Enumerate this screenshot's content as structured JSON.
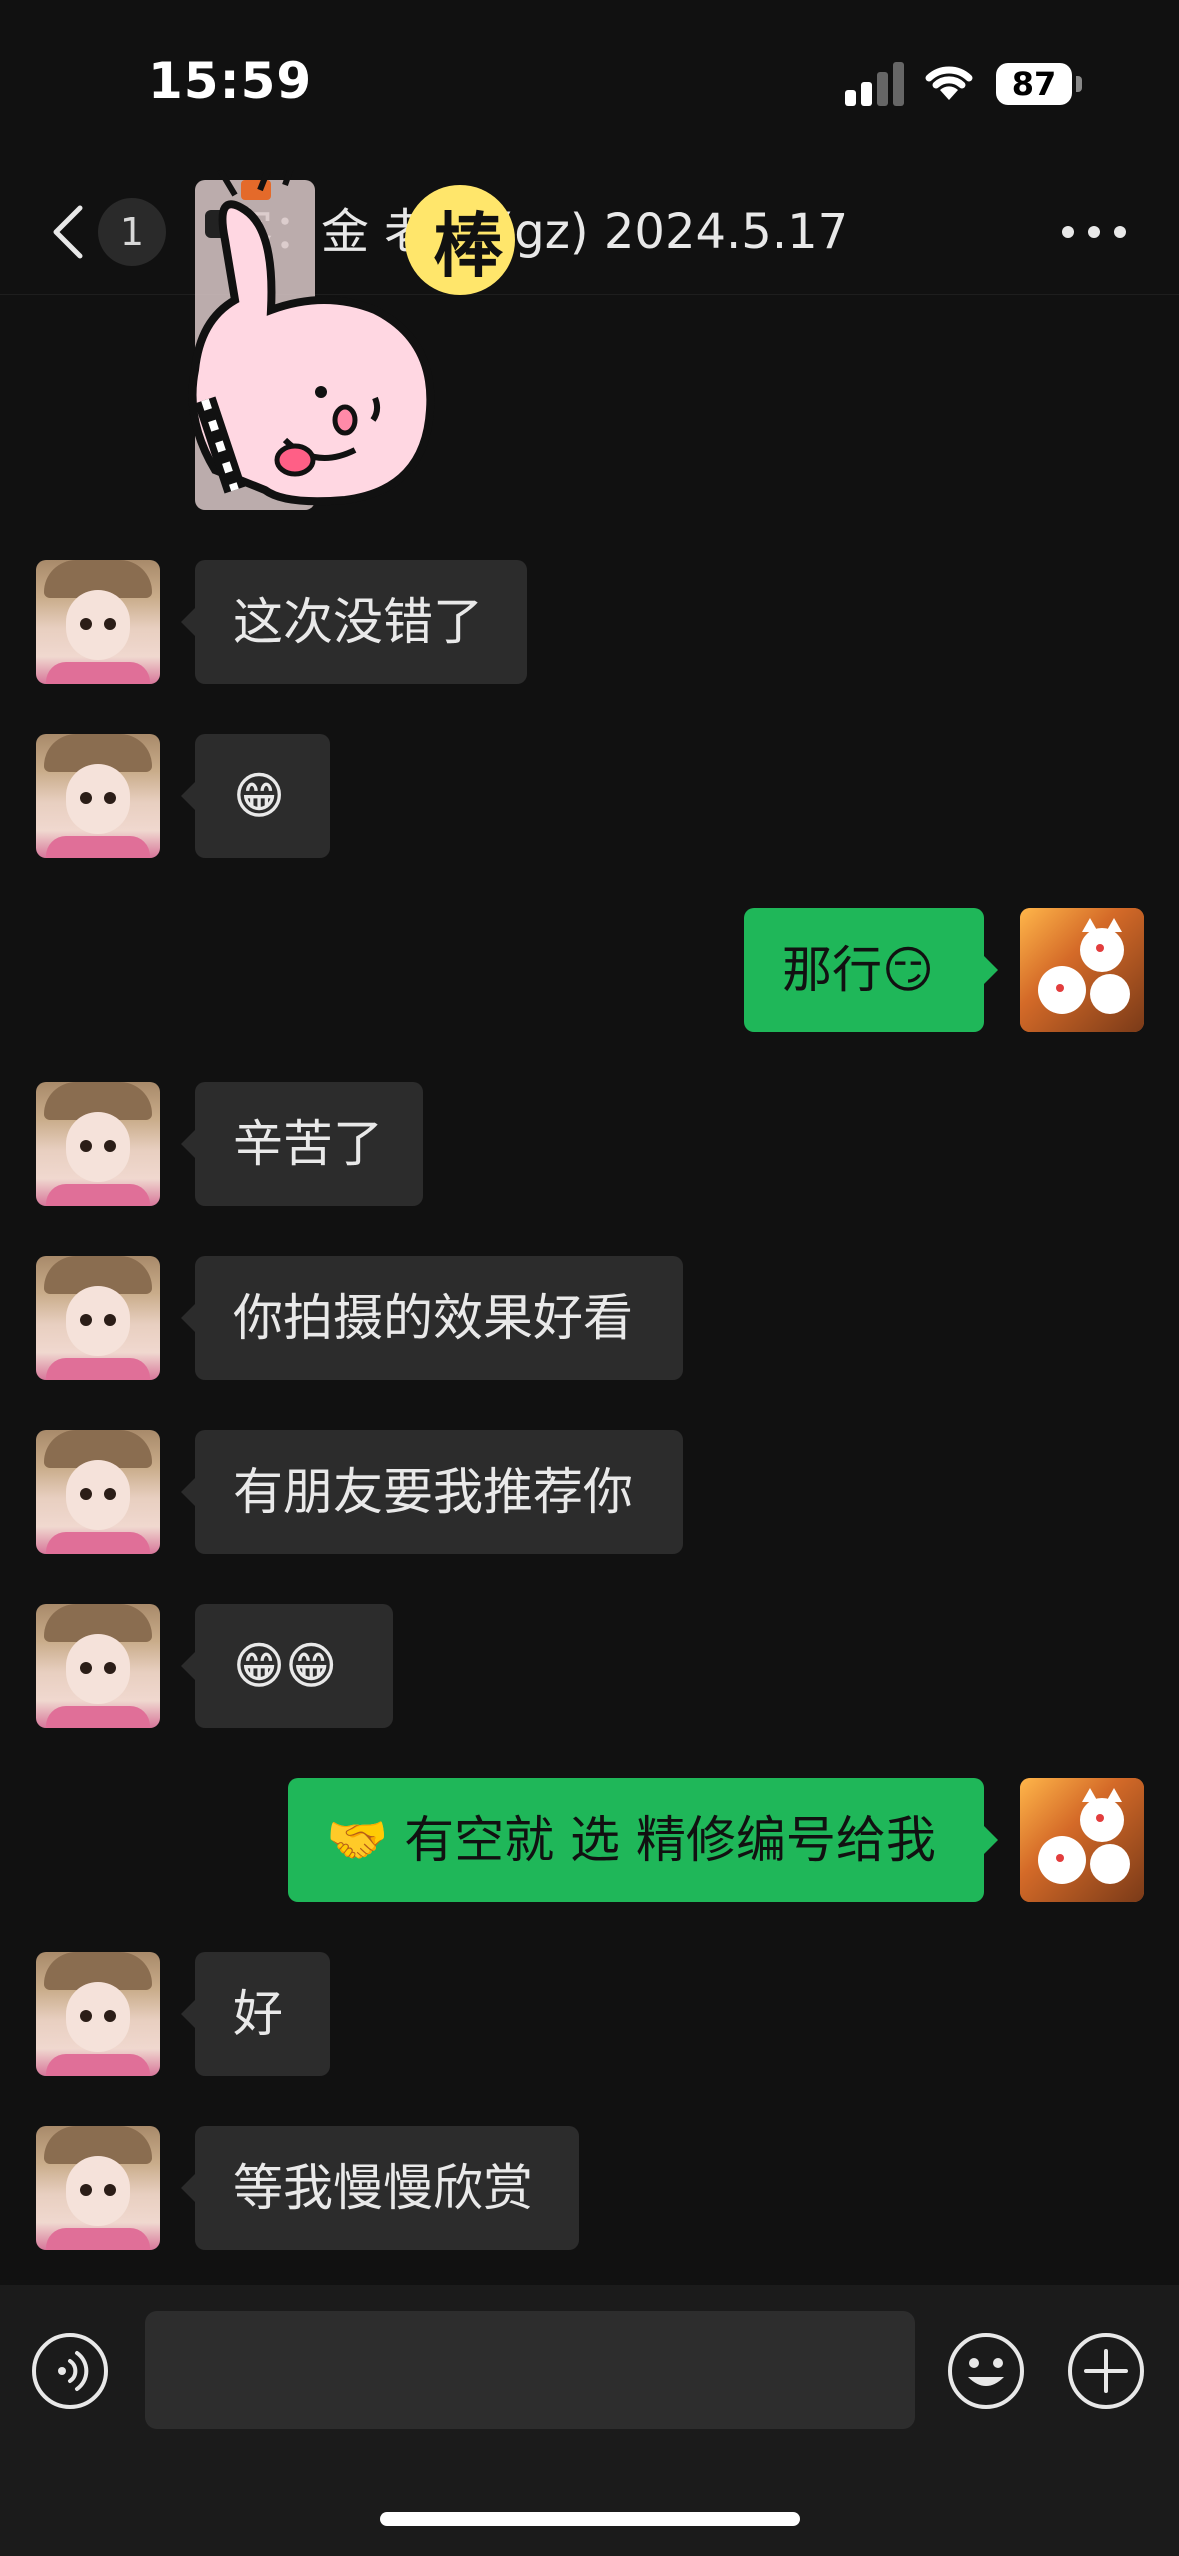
{
  "status_bar": {
    "time": "15:59",
    "battery": "87"
  },
  "nav": {
    "unread_count": "1",
    "title": "客：金 老师 (gz) 2024.5.17"
  },
  "sticker": {
    "text": "棒"
  },
  "messages": [
    {
      "side": "in",
      "text": "这次没错了"
    },
    {
      "side": "in",
      "text": "😁"
    },
    {
      "side": "out",
      "text": "那行😏"
    },
    {
      "side": "in",
      "text": "辛苦了"
    },
    {
      "side": "in",
      "text": "你拍摄的效果好看"
    },
    {
      "side": "in",
      "text": "有朋友要我推荐你"
    },
    {
      "side": "in",
      "text": "😁😁"
    },
    {
      "side": "out",
      "text": "🤝 有空就 选 精修编号给我"
    },
    {
      "side": "in",
      "text": "好"
    },
    {
      "side": "in",
      "text": "等我慢慢欣赏"
    }
  ],
  "input_bar": {
    "placeholder": ""
  },
  "icons": {
    "back": "chevron-left-icon",
    "more": "more-dots-icon",
    "voice": "voice-icon",
    "emoji": "emoji-icon",
    "plus": "plus-icon"
  },
  "colors": {
    "background": "#111111",
    "incoming_bubble": "#2c2c2c",
    "outgoing_bubble": "#1fb759"
  }
}
